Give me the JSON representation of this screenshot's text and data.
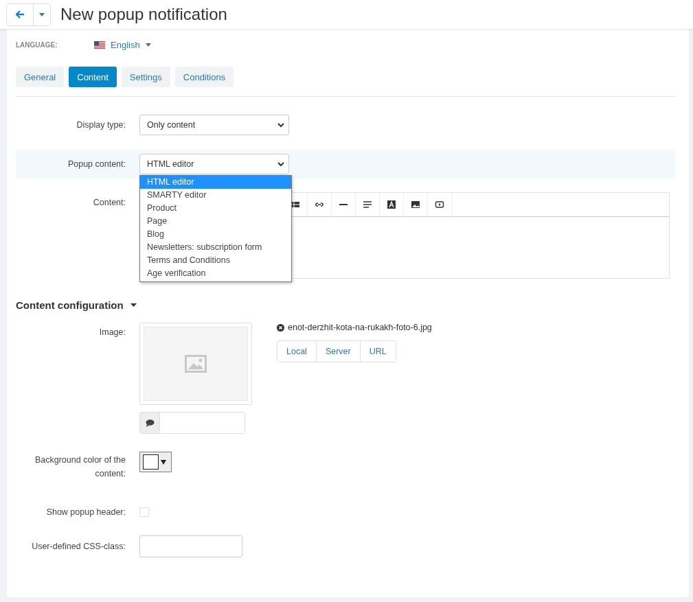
{
  "header": {
    "title": "New popup notification"
  },
  "language": {
    "label": "LANGUAGE:",
    "value": "English"
  },
  "tabs": [
    {
      "label": "General",
      "selected": false
    },
    {
      "label": "Content",
      "selected": true
    },
    {
      "label": "Settings",
      "selected": false
    },
    {
      "label": "Conditions",
      "selected": false
    }
  ],
  "display_type": {
    "label": "Display type:",
    "value": "Only content"
  },
  "popup_content": {
    "label": "Popup content:",
    "value": "HTML editor",
    "expanded": true,
    "options": [
      {
        "label": "HTML editor",
        "selected": true
      },
      {
        "label": "SMARTY editor",
        "selected": false
      },
      {
        "label": "Product",
        "selected": false
      },
      {
        "label": "Page",
        "selected": false
      },
      {
        "label": "Blog",
        "selected": false
      },
      {
        "label": "Newsletters: subscription form",
        "selected": false
      },
      {
        "label": "Terms and Conditions",
        "selected": false
      },
      {
        "label": "Age verification",
        "selected": false
      }
    ]
  },
  "content": {
    "label": "Content:"
  },
  "section": {
    "title": "Content configuration",
    "expanded": true
  },
  "image": {
    "label": "Image:",
    "file": "enot-derzhit-kota-na-rukakh-foto-6.jpg",
    "sources": [
      "Local",
      "Server",
      "URL"
    ]
  },
  "background": {
    "label": "Background color of the content:"
  },
  "show_header": {
    "label": "Show popup header:",
    "checked": false
  },
  "css_class": {
    "label": "User-defined CSS-class:"
  }
}
